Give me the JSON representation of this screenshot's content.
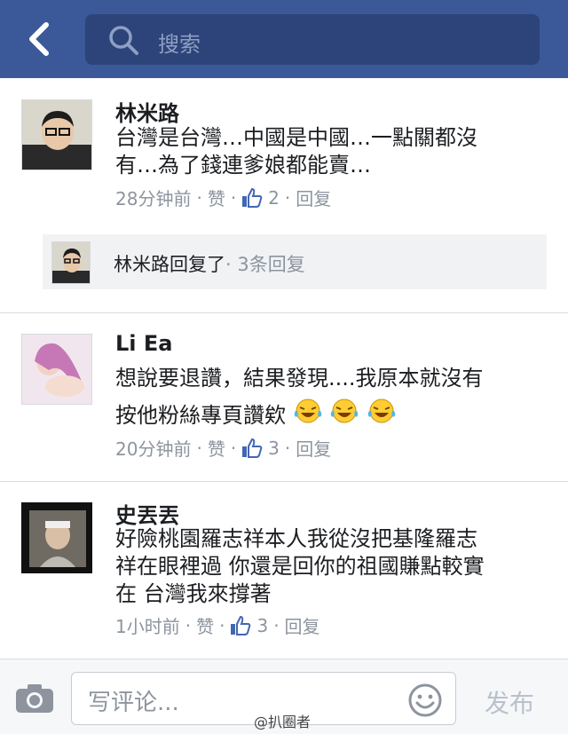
{
  "header": {
    "search_placeholder": "搜索"
  },
  "comments": [
    {
      "name": "林米路",
      "text_line1": "台灣是台灣…中國是中國…一點關都沒",
      "text_line2": "有…為了錢連爹娘都能賣…",
      "time": "28分钟前",
      "like_label": "赞",
      "likes": "2",
      "reply_label": "回复"
    },
    {
      "name": "Li Ea",
      "text_line1": "想說要退讚，結果發現....我原本就沒有",
      "text_line2": "按他粉絲專頁讚欸",
      "time": "20分钟前",
      "like_label": "赞",
      "likes": "3",
      "reply_label": "回复"
    },
    {
      "name": "史丟丟",
      "text_line1": "好險桃園羅志祥本人我從沒把基隆羅志",
      "text_line2": "祥在眼裡過 你還是回你的祖國賺點較實",
      "text_line3": "在 台灣我來撐著",
      "time": "1小时前",
      "like_label": "赞",
      "likes": "3",
      "reply_label": "回复"
    }
  ],
  "reply_summary": {
    "who": "林米路回复了",
    "count": "· 3条回复"
  },
  "composer": {
    "placeholder": "写评论...",
    "send_label": "发布"
  },
  "watermark": "@扒圈者",
  "colors": {
    "header": "#3b5998",
    "search": "#2c4479",
    "like_blue": "#4267b2"
  }
}
